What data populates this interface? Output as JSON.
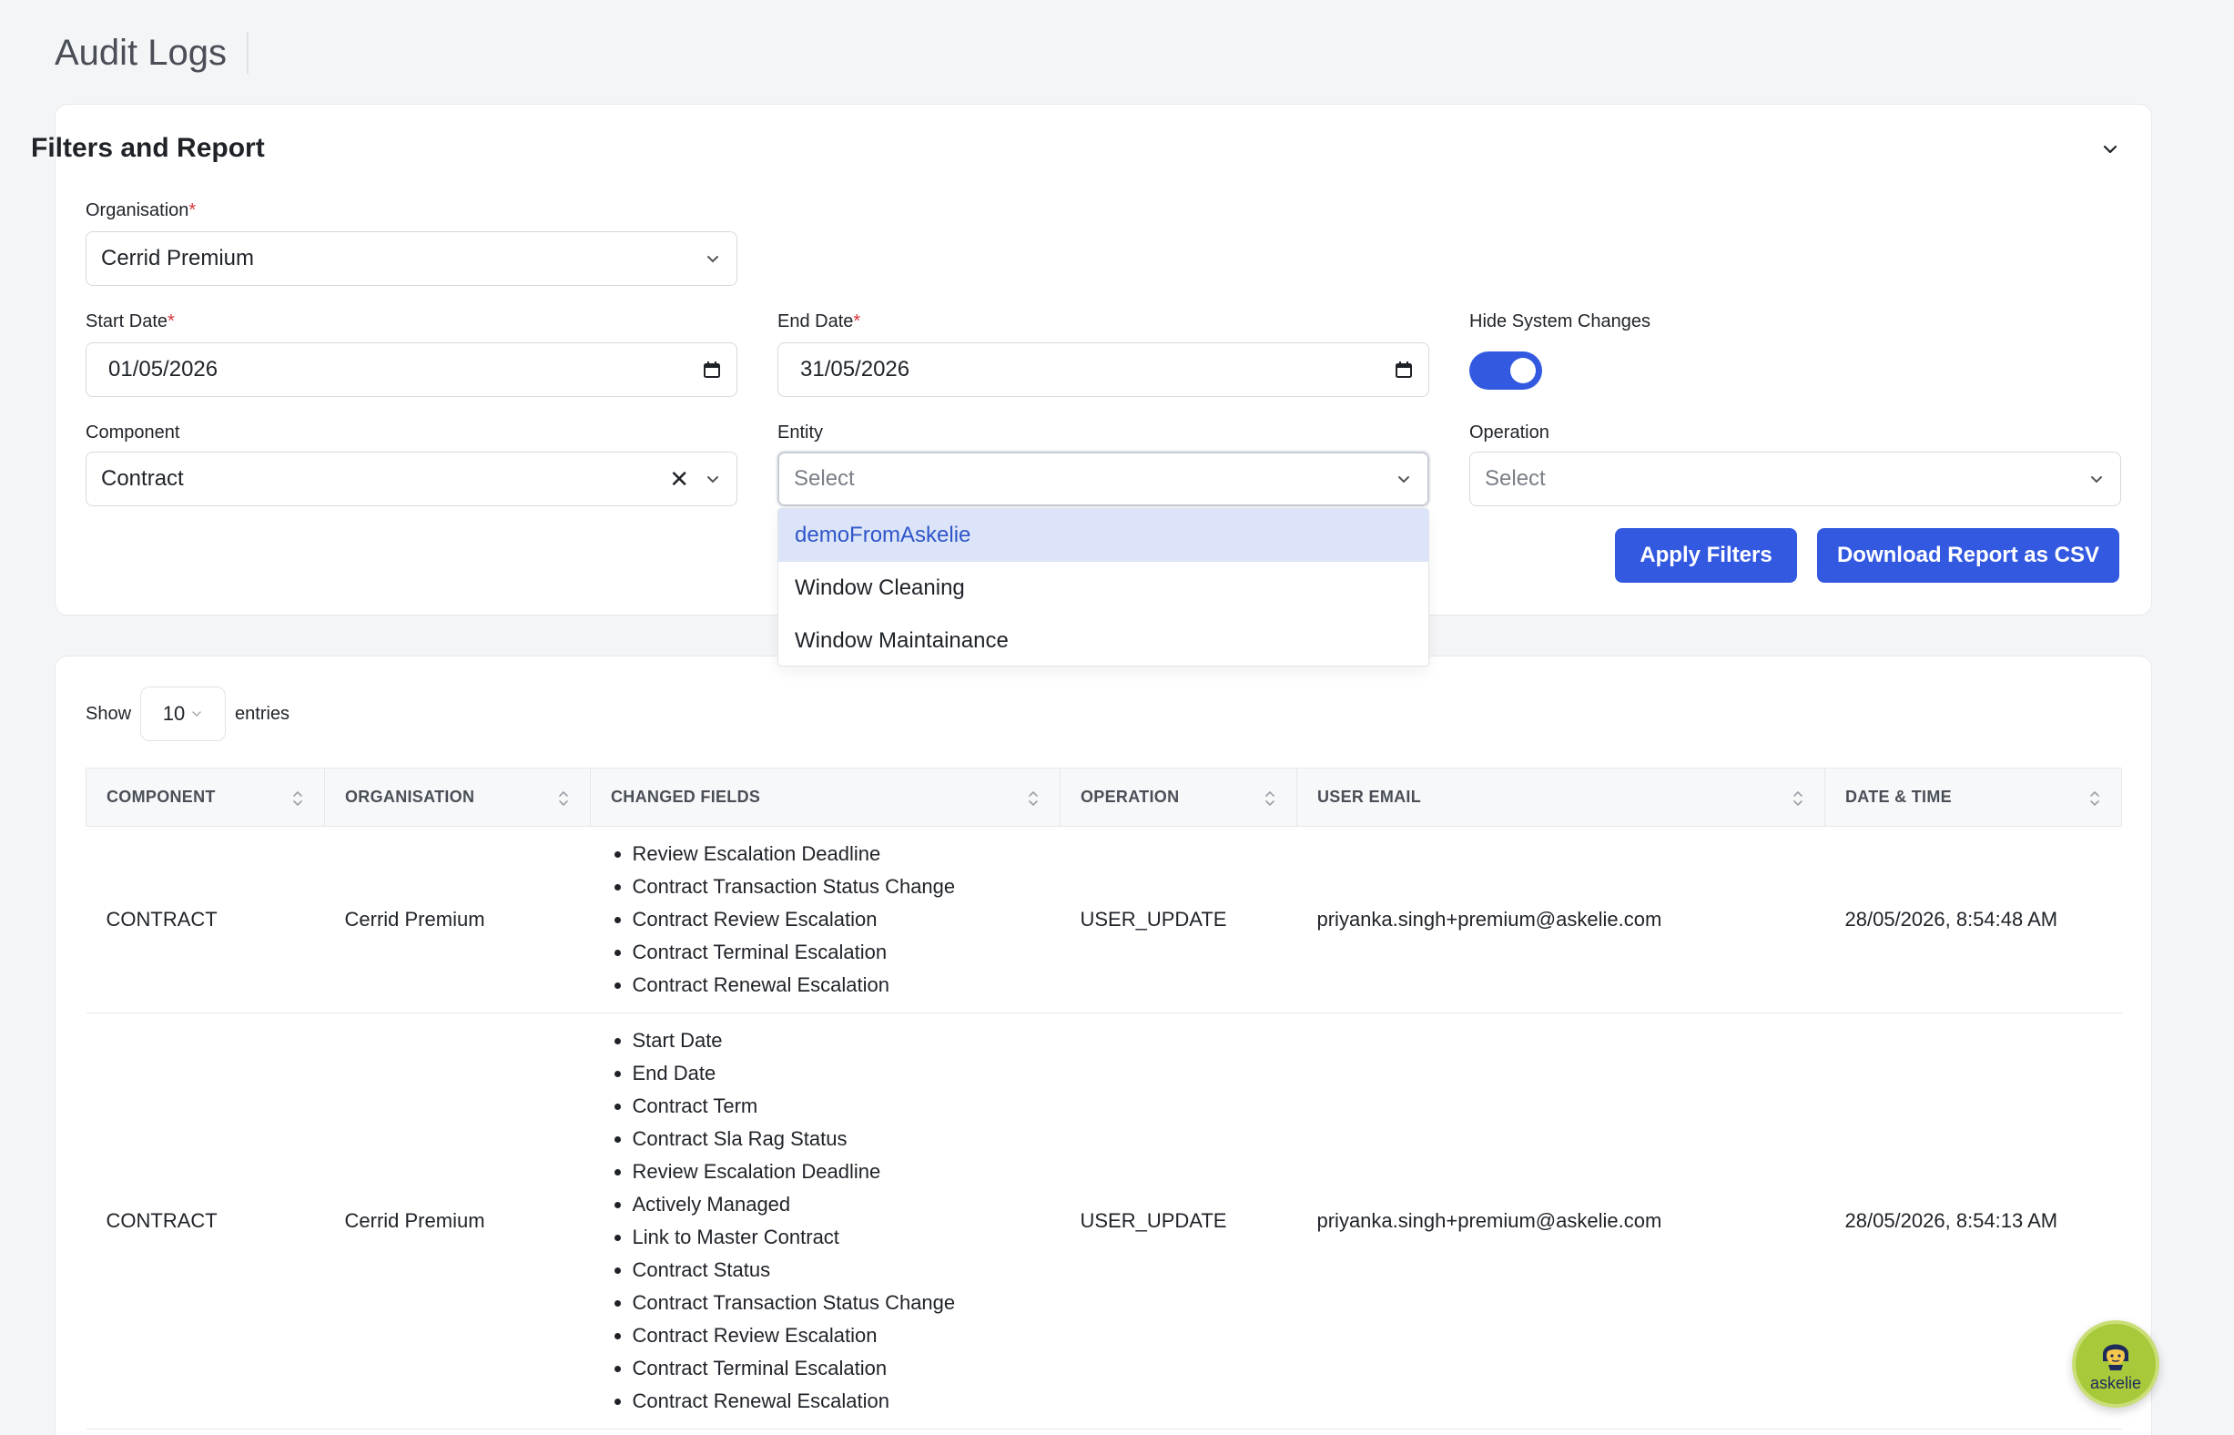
{
  "page": {
    "title": "Audit Logs"
  },
  "filters": {
    "title": "Filters and Report",
    "organisation": {
      "label": "Organisation",
      "required_mark": "*",
      "value": "Cerrid Premium"
    },
    "start_date": {
      "label": "Start Date",
      "required_mark": "*",
      "value": "01/05/2026"
    },
    "end_date": {
      "label": "End Date",
      "required_mark": "*",
      "value": "31/05/2026"
    },
    "hide_system_changes": {
      "label": "Hide System Changes",
      "enabled": true
    },
    "component": {
      "label": "Component",
      "value": "Contract"
    },
    "entity": {
      "label": "Entity",
      "placeholder": "Select",
      "options": [
        "demoFromAskelie",
        "Window Cleaning",
        "Window Maintainance"
      ],
      "highlighted": "demoFromAskelie"
    },
    "operation": {
      "label": "Operation",
      "placeholder": "Select"
    },
    "apply_label": "Apply Filters",
    "download_label": "Download Report as CSV"
  },
  "table": {
    "show_label": "Show",
    "entries_value": "10",
    "entries_label": "entries",
    "columns": [
      "COMPONENT",
      "ORGANISATION",
      "CHANGED FIELDS",
      "OPERATION",
      "USER EMAIL",
      "DATE & TIME"
    ],
    "rows": [
      {
        "component": "CONTRACT",
        "organisation": "Cerrid Premium",
        "changed_fields": [
          "Review Escalation Deadline",
          "Contract Transaction Status Change",
          "Contract Review Escalation",
          "Contract Terminal Escalation",
          "Contract Renewal Escalation"
        ],
        "operation": "USER_UPDATE",
        "user_email": "priyanka.singh+premium@askelie.com",
        "datetime": "28/05/2026, 8:54:48 AM"
      },
      {
        "component": "CONTRACT",
        "organisation": "Cerrid Premium",
        "changed_fields": [
          "Start Date",
          "End Date",
          "Contract Term",
          "Contract Sla Rag Status",
          "Review Escalation Deadline",
          "Actively Managed",
          "Link to Master Contract",
          "Contract Status",
          "Contract Transaction Status Change",
          "Contract Review Escalation",
          "Contract Terminal Escalation",
          "Contract Renewal Escalation"
        ],
        "operation": "USER_UPDATE",
        "user_email": "priyanka.singh+premium@askelie.com",
        "datetime": "28/05/2026, 8:54:13 AM"
      }
    ]
  },
  "assistant": {
    "label": "askelie",
    "icon": "assistant-avatar-icon"
  },
  "colors": {
    "primary": "#3359e0",
    "required": "#d9363e",
    "highlight_bg": "#dbe4f8",
    "badge": "#a8c93a"
  }
}
